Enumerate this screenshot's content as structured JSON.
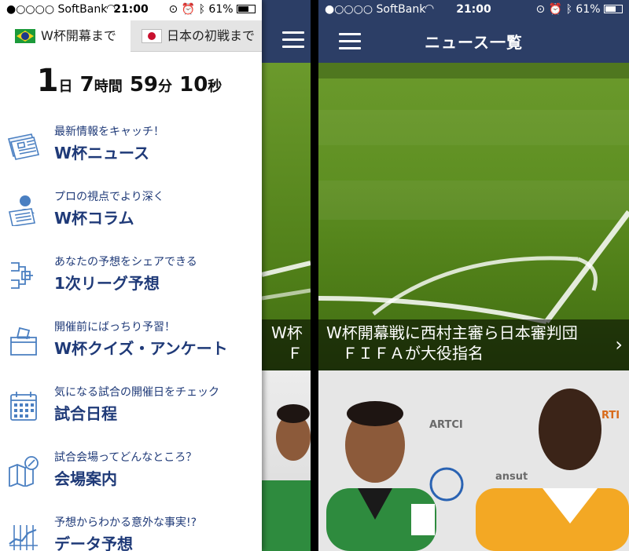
{
  "status_bar": {
    "carrier": "●○○○○ SoftBank",
    "time": "21:00",
    "battery": "61%"
  },
  "menu": {
    "tabs": [
      {
        "label": "W杯開幕まで",
        "flag": "brazil-flag-icon"
      },
      {
        "label": "日本の初戦まで",
        "flag": "japan-flag-icon"
      }
    ],
    "countdown": {
      "days": "1",
      "days_unit": "日",
      "hours": "7",
      "hours_unit": "時間",
      "minutes": "59",
      "minutes_unit": "分",
      "seconds": "10",
      "seconds_unit": "秒"
    },
    "items": [
      {
        "subtitle": "最新情報をキャッチ！",
        "title": "W杯ニュース",
        "icon": "newspaper-icon"
      },
      {
        "subtitle": "プロの視点でより深く",
        "title": "W杯コラム",
        "icon": "columnist-icon"
      },
      {
        "subtitle": "あなたの予想をシェアできる",
        "title": "1次リーグ予想",
        "icon": "bracket-icon"
      },
      {
        "subtitle": "開催前にばっちり予習！",
        "title": "W杯クイズ・アンケート",
        "icon": "ballot-box-icon"
      },
      {
        "subtitle": "気になる試合の開催日をチェック",
        "title": "試合日程",
        "icon": "calendar-icon"
      },
      {
        "subtitle": "試合会場ってどんなところ？",
        "title": "会場案内",
        "icon": "map-compass-icon"
      },
      {
        "subtitle": "予想からわかる意外な事実!?",
        "title": "データ予想",
        "icon": "line-chart-icon"
      }
    ],
    "peek_headline": "W杯\n　Ｆ"
  },
  "news": {
    "title": "ニュース一覧",
    "headline": "W杯開幕戦に西村主審ら日本審判団\n　ＦＩＦＡが大役指名",
    "press_logos": [
      "ARTCI",
      "ansut",
      "RTI"
    ]
  },
  "colors": {
    "navy": "#2c3e66",
    "menu_text": "#1f3a78",
    "icon_blue": "#4a7fc1"
  }
}
